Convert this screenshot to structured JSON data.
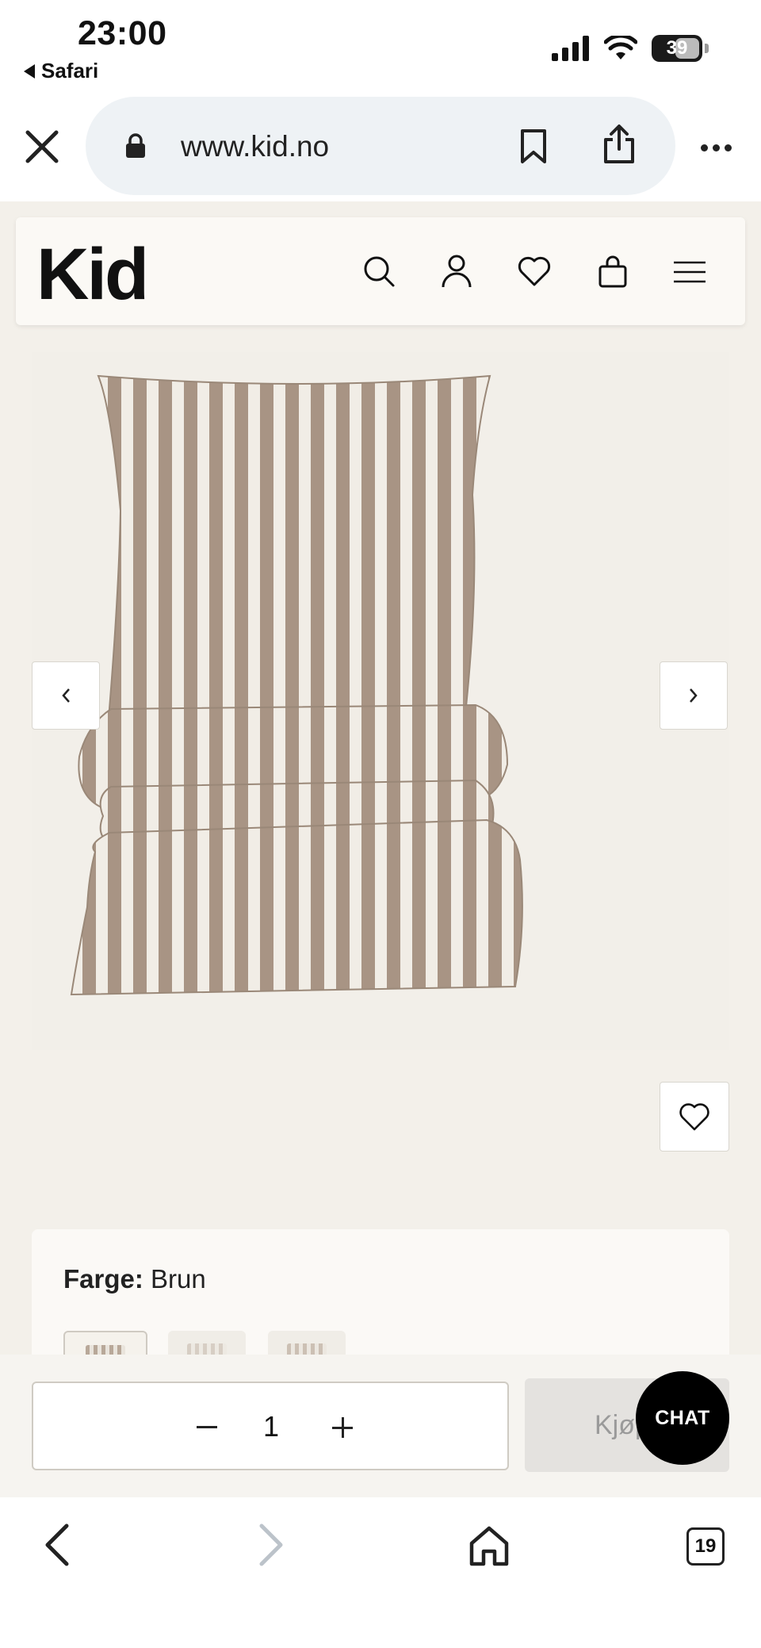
{
  "status_bar": {
    "time": "23:00",
    "back_app": "Safari",
    "battery": "39"
  },
  "browser": {
    "url": "www.kid.no",
    "tab_count": "19"
  },
  "site": {
    "logo": "Kid"
  },
  "product": {
    "color_label": "Farge:",
    "color_value": "Brun",
    "swatch_count": 3
  },
  "buy_bar": {
    "quantity": "1",
    "buy_label": "Kjøp",
    "chat_label": "CHAT"
  },
  "colors": {
    "page_bg": "#f3f0ea",
    "stripe_brown": "#a89484",
    "stripe_white": "#f1ede6",
    "chat_bg": "#000000"
  }
}
